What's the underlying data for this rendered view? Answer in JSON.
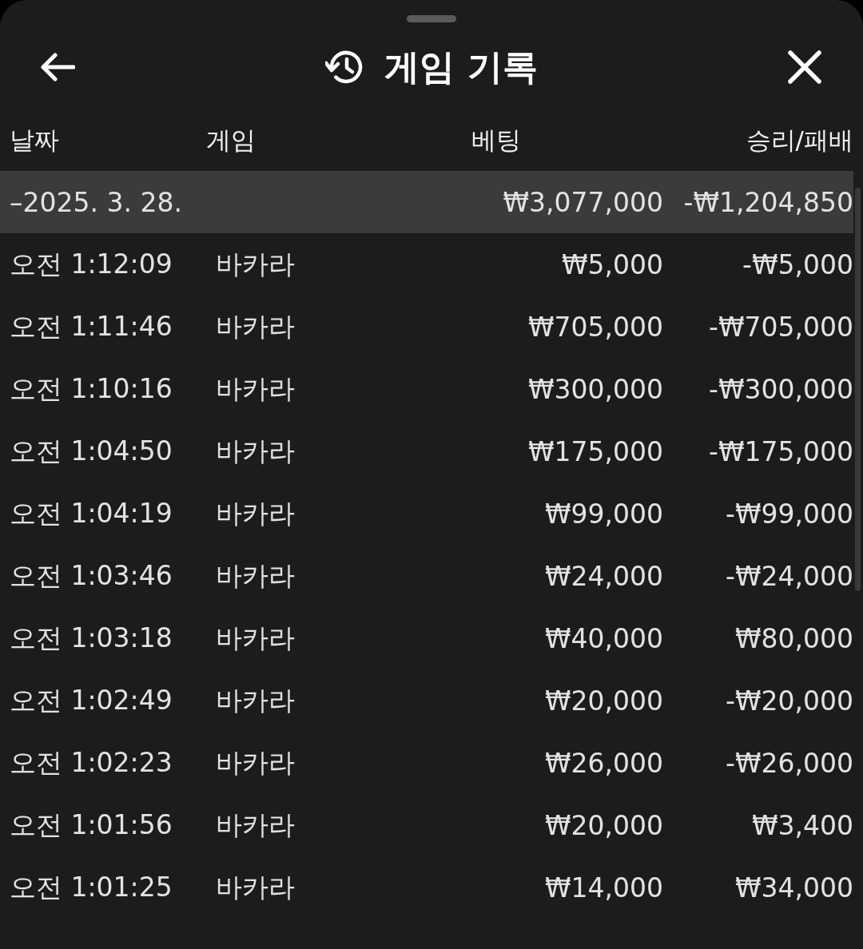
{
  "header": {
    "title": "게임 기록"
  },
  "columns": [
    "날짜",
    "게임",
    "베팅",
    "승리/패배"
  ],
  "group": {
    "date": "–2025. 3. 28.",
    "bet": "₩3,077,000",
    "result": "-₩1,204,850"
  },
  "rows": [
    {
      "time": "오전 1:12:09",
      "game": "바카라",
      "bet": "₩5,000",
      "result": "-₩5,000"
    },
    {
      "time": "오전 1:11:46",
      "game": "바카라",
      "bet": "₩705,000",
      "result": "-₩705,000"
    },
    {
      "time": "오전 1:10:16",
      "game": "바카라",
      "bet": "₩300,000",
      "result": "-₩300,000"
    },
    {
      "time": "오전 1:04:50",
      "game": "바카라",
      "bet": "₩175,000",
      "result": "-₩175,000"
    },
    {
      "time": "오전 1:04:19",
      "game": "바카라",
      "bet": "₩99,000",
      "result": "-₩99,000"
    },
    {
      "time": "오전 1:03:46",
      "game": "바카라",
      "bet": "₩24,000",
      "result": "-₩24,000"
    },
    {
      "time": "오전 1:03:18",
      "game": "바카라",
      "bet": "₩40,000",
      "result": "₩80,000"
    },
    {
      "time": "오전 1:02:49",
      "game": "바카라",
      "bet": "₩20,000",
      "result": "-₩20,000"
    },
    {
      "time": "오전 1:02:23",
      "game": "바카라",
      "bet": "₩26,000",
      "result": "-₩26,000"
    },
    {
      "time": "오전 1:01:56",
      "game": "바카라",
      "bet": "₩20,000",
      "result": "₩3,400"
    },
    {
      "time": "오전 1:01:25",
      "game": "바카라",
      "bet": "₩14,000",
      "result": "₩34,000"
    }
  ]
}
